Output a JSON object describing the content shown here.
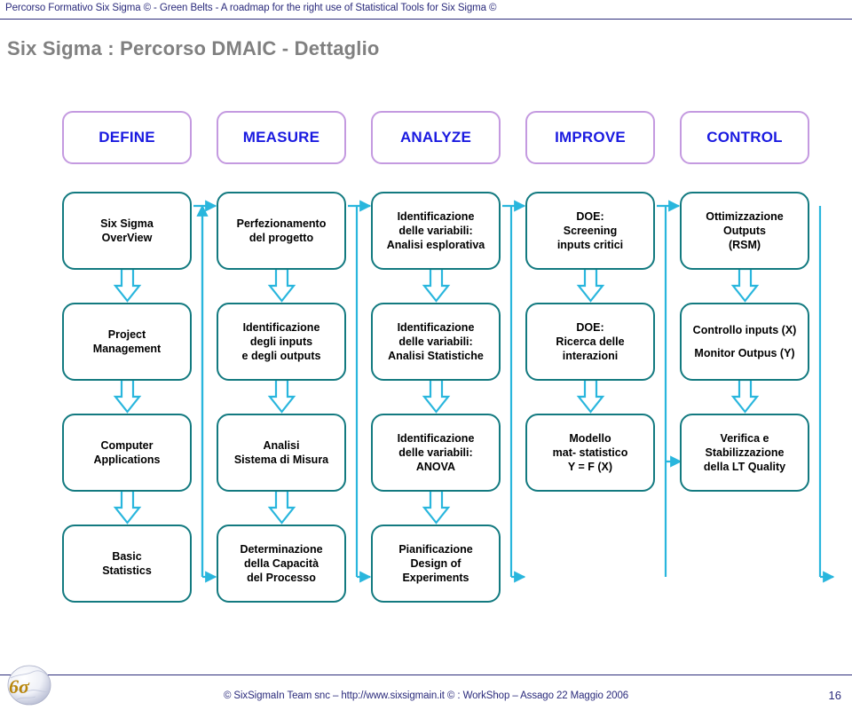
{
  "banner": {
    "text": "Percorso Formativo Six Sigma © - Green Belts - A roadmap for the right use of Statistical Tools for Six Sigma ©"
  },
  "title": "Six Sigma : Percorso DMAIC  - Dettaglio",
  "colors": {
    "banner_text": "#2b2b7c",
    "title_gray": "#808080",
    "phase_border": "#c49ae0",
    "phase_text": "#1a1ae0",
    "box_border": "#137a80",
    "box_text": "#000000",
    "arrow": "#29b6dd",
    "footer_text": "#2b2b7c"
  },
  "phases": [
    {
      "label": "DEFINE"
    },
    {
      "label": "MEASURE"
    },
    {
      "label": "ANALYZE"
    },
    {
      "label": "IMPROVE"
    },
    {
      "label": "CONTROL"
    }
  ],
  "rows": [
    {
      "row_index": 1,
      "boxes": [
        {
          "lines": [
            "Six Sigma",
            "OverView"
          ]
        },
        {
          "lines": [
            "Perfezionamento",
            "del progetto"
          ]
        },
        {
          "lines": [
            "Identificazione",
            "delle variabili:",
            "Analisi esplorativa"
          ]
        },
        {
          "lines": [
            "DOE:",
            "Screening",
            "inputs critici"
          ]
        },
        {
          "lines": [
            "Ottimizzazione",
            "Outputs",
            "(RSM)"
          ]
        }
      ]
    },
    {
      "row_index": 2,
      "boxes": [
        {
          "lines": [
            "Project",
            "Management"
          ]
        },
        {
          "lines": [
            "Identificazione",
            "degli inputs",
            "e degli outputs"
          ]
        },
        {
          "lines": [
            "Identificazione",
            "delle variabili:",
            "Analisi Statistiche"
          ]
        },
        {
          "lines": [
            "DOE:",
            "Ricerca delle",
            "interazioni"
          ]
        },
        {
          "lines": [
            "Controllo inputs (X)",
            "Monitor Outpus (Y)"
          ],
          "overflow": true
        }
      ]
    },
    {
      "row_index": 3,
      "boxes": [
        {
          "lines": [
            "Computer",
            "Applications"
          ]
        },
        {
          "lines": [
            "Analisi",
            "Sistema di Misura"
          ]
        },
        {
          "lines": [
            "Identificazione",
            "delle variabili:",
            "ANOVA"
          ]
        },
        {
          "lines": [
            "Modello",
            "mat- statistico",
            "Y = F (X)"
          ]
        },
        {
          "lines": [
            "Verifica e",
            "Stabilizzazione",
            "della LT Quality"
          ]
        }
      ]
    },
    {
      "row_index": 4,
      "boxes": [
        {
          "lines": [
            "Basic",
            "Statistics"
          ]
        },
        {
          "lines": [
            "Determinazione",
            "della Capacità",
            "del Processo"
          ]
        },
        {
          "lines": [
            "Pianificazione",
            "Design of",
            "Experiments"
          ]
        }
      ]
    }
  ],
  "footer": {
    "text": "© SixSigmaIn Team snc – http://www.sixsigmain.it © : WorkShop  – Assago 22 Maggio 2006",
    "page_number": "16",
    "logo_label": "6σ"
  }
}
